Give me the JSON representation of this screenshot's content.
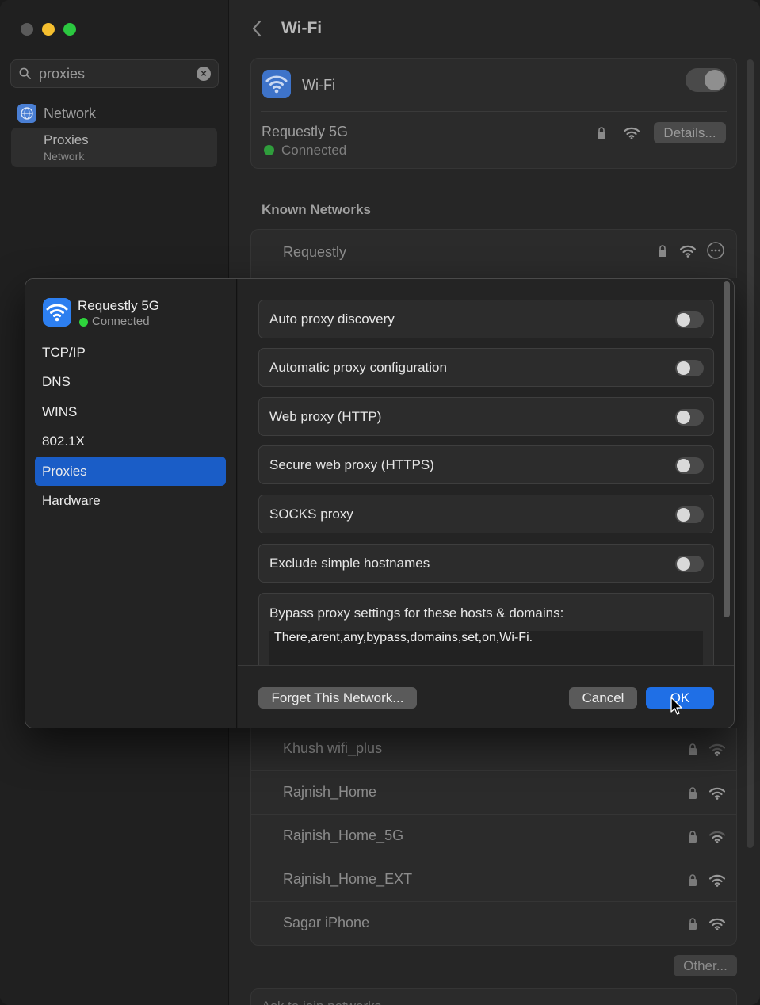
{
  "sidebar": {
    "search_value": "proxies",
    "items": [
      {
        "label": "Network"
      },
      {
        "label": "Proxies",
        "sublabel": "Network"
      }
    ]
  },
  "header": {
    "title": "Wi-Fi"
  },
  "wifi_card": {
    "label": "Wi-Fi",
    "current_network": "Requestly 5G",
    "status": "Connected",
    "details_label": "Details..."
  },
  "known_networks": {
    "title": "Known Networks",
    "top_item": "Requestly",
    "items": [
      "Khush wifi_plus",
      "Rajnish_Home",
      "Rajnish_Home_5G",
      "Rajnish_Home_EXT",
      "Sagar iPhone"
    ],
    "other_label": "Other...",
    "ask_label": "Ask to join networks"
  },
  "dialog": {
    "network_name": "Requestly 5G",
    "network_status": "Connected",
    "nav": [
      "TCP/IP",
      "DNS",
      "WINS",
      "802.1X",
      "Proxies",
      "Hardware"
    ],
    "active_nav": "Proxies",
    "proxy_options": [
      {
        "label": "Auto proxy discovery",
        "enabled": false
      },
      {
        "label": "Automatic proxy configuration",
        "enabled": false
      },
      {
        "label": "Web proxy (HTTP)",
        "enabled": false
      },
      {
        "label": "Secure web proxy (HTTPS)",
        "enabled": false
      },
      {
        "label": "SOCKS proxy",
        "enabled": false
      },
      {
        "label": "Exclude simple hostnames",
        "enabled": false
      }
    ],
    "bypass_label": "Bypass proxy settings for these hosts & domains:",
    "bypass_value": "There,arent,any,bypass,domains,set,on,Wi-Fi.",
    "forget_label": "Forget This Network...",
    "cancel_label": "Cancel",
    "ok_label": "OK"
  },
  "colors": {
    "accent": "#1f6fe6",
    "selected_nav": "#1a5dc7",
    "connected": "#2ed43c"
  }
}
